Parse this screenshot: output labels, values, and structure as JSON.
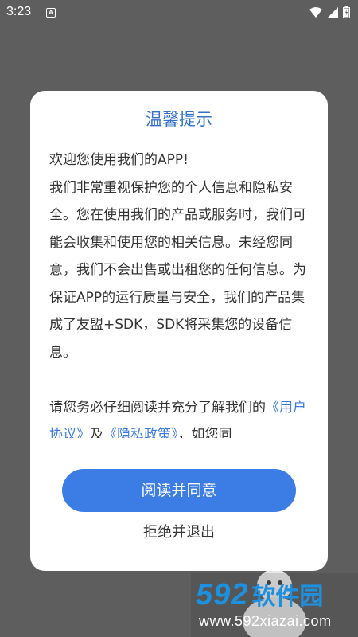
{
  "status_bar": {
    "time": "3:23",
    "notification_icon_letter": "A",
    "icons": [
      "wifi-icon",
      "signal-icon",
      "battery-icon"
    ]
  },
  "dialog": {
    "title": "温馨提示",
    "body": {
      "p1_line1": "欢迎您使用我们的APP!",
      "p1_rest": "我们非常重视保护您的个人信息和隐私安全。您在使用我们的产品或服务时，我们可能会收集和使用您的相关信息。未经您同意，我们不会出售或出租您的任何信息。为保证APP的运行质量与安全，我们的产品集成了友盟+SDK，SDK将采集您的设备信息。",
      "p2_text": "请您务必仔细阅读并充分了解我们的",
      "user_agreement_link": "《用户协议》",
      "and_text": "及",
      "privacy_policy_link": "《隐私政策》",
      "p2_tail": "，如您同"
    },
    "agree_button_label": "阅读并同意",
    "exit_button_label": "拒绝并退出"
  },
  "watermark": {
    "brand_number": "592",
    "brand_name": "软件园",
    "url": "www.592xiazai.com"
  },
  "colors": {
    "title": "#3571c9",
    "button": "#3c7de5",
    "link": "#3b7be0",
    "overlay": "#5e5e5e"
  }
}
